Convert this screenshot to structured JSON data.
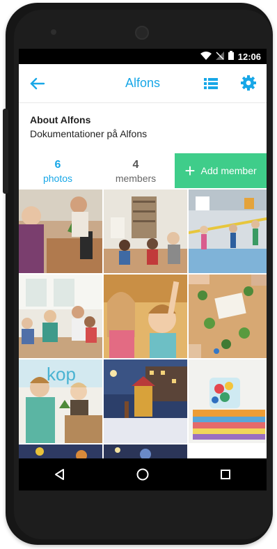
{
  "status": {
    "time": "12:06"
  },
  "appbar": {
    "title": "Alfons"
  },
  "about": {
    "heading": "About Alfons",
    "description": "Dokumentationer på Alfons"
  },
  "stats": {
    "photos": {
      "count": "6",
      "label": "photos"
    },
    "members": {
      "count": "4",
      "label": "members"
    }
  },
  "actions": {
    "add_member_label": "Add member"
  },
  "colors": {
    "accent": "#18a7e7",
    "add_button": "#3fcd8a"
  },
  "icons": {
    "back": "arrow-left-icon",
    "list": "list-icon",
    "settings": "gear-icon",
    "nav_back": "triangle-back-icon",
    "nav_home": "circle-home-icon",
    "nav_recent": "square-recents-icon"
  }
}
